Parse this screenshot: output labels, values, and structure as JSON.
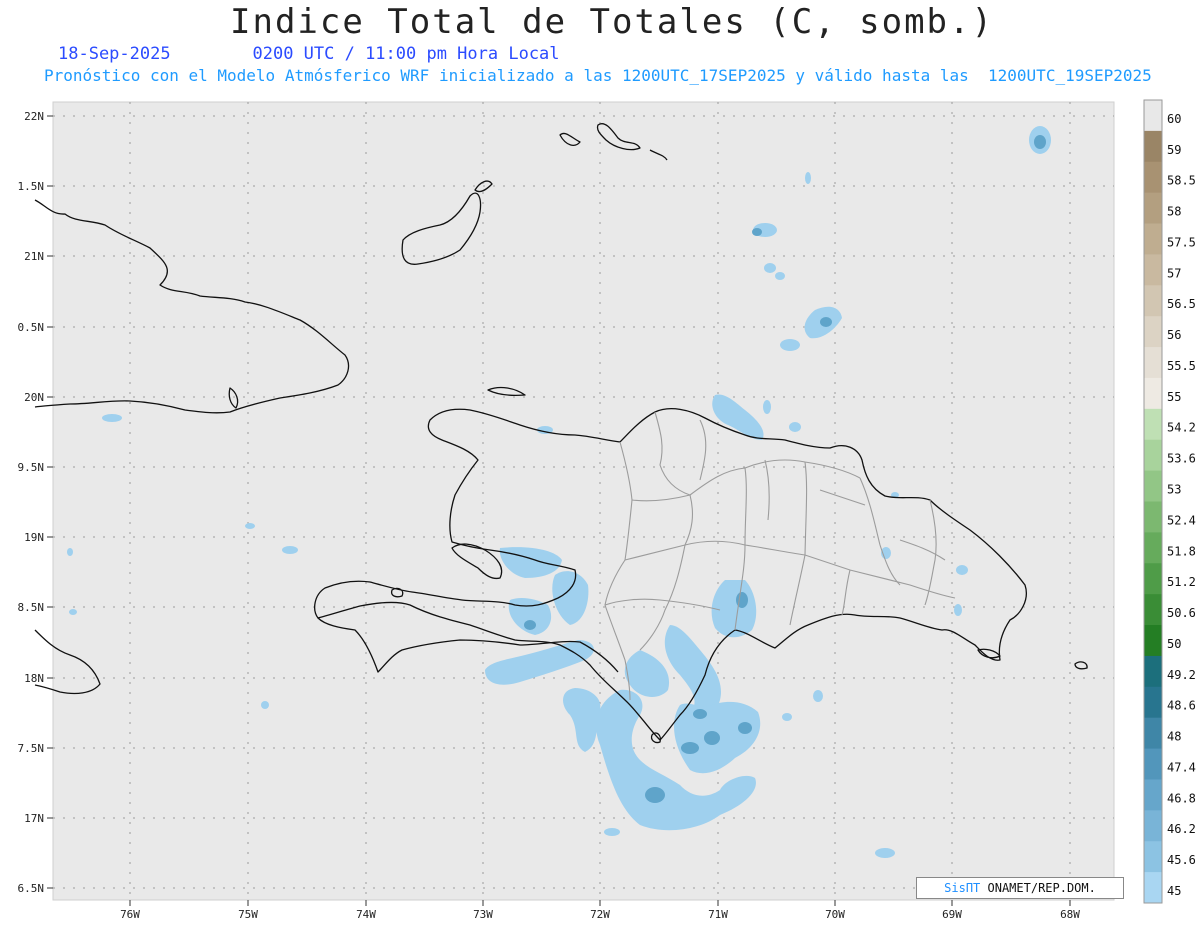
{
  "header": {
    "title": "Indice Total de Totales (C, somb.)",
    "date": "18-Sep-2025",
    "time": "0200 UTC / 11:00 pm Hora Local",
    "forecast": "Pronóstico con el Modelo Atmósferico WRF inicializado a las 1200UTC_17SEP2025 y válido hasta las  1200UTC_19SEP2025"
  },
  "axes": {
    "lat_labels": [
      "22N",
      "1.5N",
      "21N",
      "0.5N",
      "20N",
      "9.5N",
      "19N",
      "8.5N",
      "18N",
      "7.5N",
      "17N",
      "6.5N"
    ],
    "lon_labels": [
      "76W",
      "75W",
      "74W",
      "73W",
      "72W",
      "71W",
      "70W",
      "69W",
      "68W"
    ]
  },
  "colorbar": {
    "labels": [
      "60",
      "59",
      "58.5",
      "58",
      "57.5",
      "57",
      "56.5",
      "56",
      "55.5",
      "55",
      "54.2",
      "53.6",
      "53",
      "52.4",
      "51.8",
      "51.2",
      "50.6",
      "50",
      "49.2",
      "48.6",
      "48",
      "47.4",
      "46.8",
      "46.2",
      "45.6",
      "45"
    ],
    "colors": [
      "#e8e8e8",
      "#9a8566",
      "#a89272",
      "#b39f80",
      "#bfad90",
      "#c9b9a0",
      "#d2c6b2",
      "#dcd3c4",
      "#e5dfd5",
      "#eeeae3",
      "#bfe0b4",
      "#a8d39c",
      "#92c686",
      "#7cb870",
      "#66ab5c",
      "#4f9c48",
      "#3a8d36",
      "#247e24",
      "#1c6f7c",
      "#28758f",
      "#3f86a7",
      "#5296bb",
      "#66a6cb",
      "#79b4d7",
      "#8cc3e3",
      "#a9d6f2"
    ]
  },
  "credit": {
    "brand": "SisПT",
    "text": " ONAMET/REP.DOM."
  }
}
